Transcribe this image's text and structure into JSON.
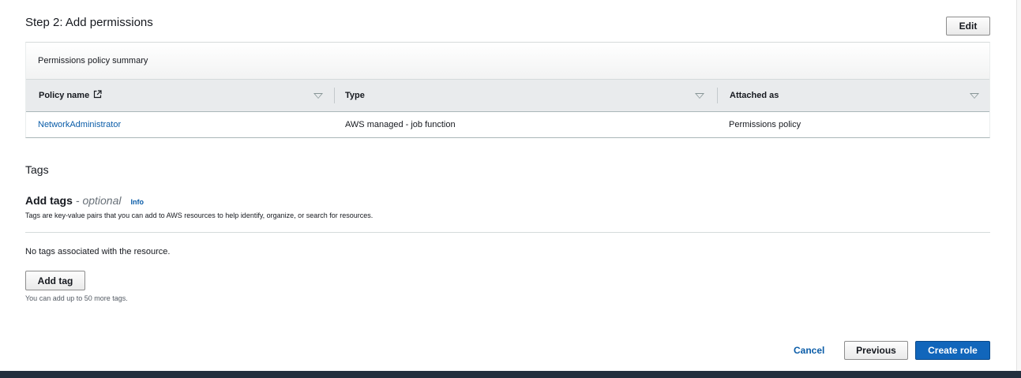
{
  "step": {
    "title": "Step 2: Add permissions",
    "edit_label": "Edit"
  },
  "permissions": {
    "summary_label": "Permissions policy summary",
    "columns": {
      "policy_name": "Policy name",
      "type": "Type",
      "attached_as": "Attached as"
    },
    "rows": [
      {
        "policy_name": "NetworkAdministrator",
        "type": "AWS managed - job function",
        "attached_as": "Permissions policy"
      }
    ]
  },
  "tags": {
    "section_title": "Tags",
    "add_title": "Add tags",
    "optional_label": "- optional",
    "info_label": "Info",
    "description": "Tags are key-value pairs that you can add to AWS resources to help identify, organize, or search for resources.",
    "empty_message": "No tags associated with the resource.",
    "add_button": "Add tag",
    "limit_hint": "You can add up to 50 more tags."
  },
  "footer": {
    "cancel": "Cancel",
    "previous": "Previous",
    "create": "Create role"
  },
  "colors": {
    "primary": "#1166bb",
    "link": "#0a5ca8",
    "footer_bar": "#232f3e"
  },
  "icons": {
    "external_link": "external-link-icon",
    "sort": "sort-caret-icon"
  }
}
